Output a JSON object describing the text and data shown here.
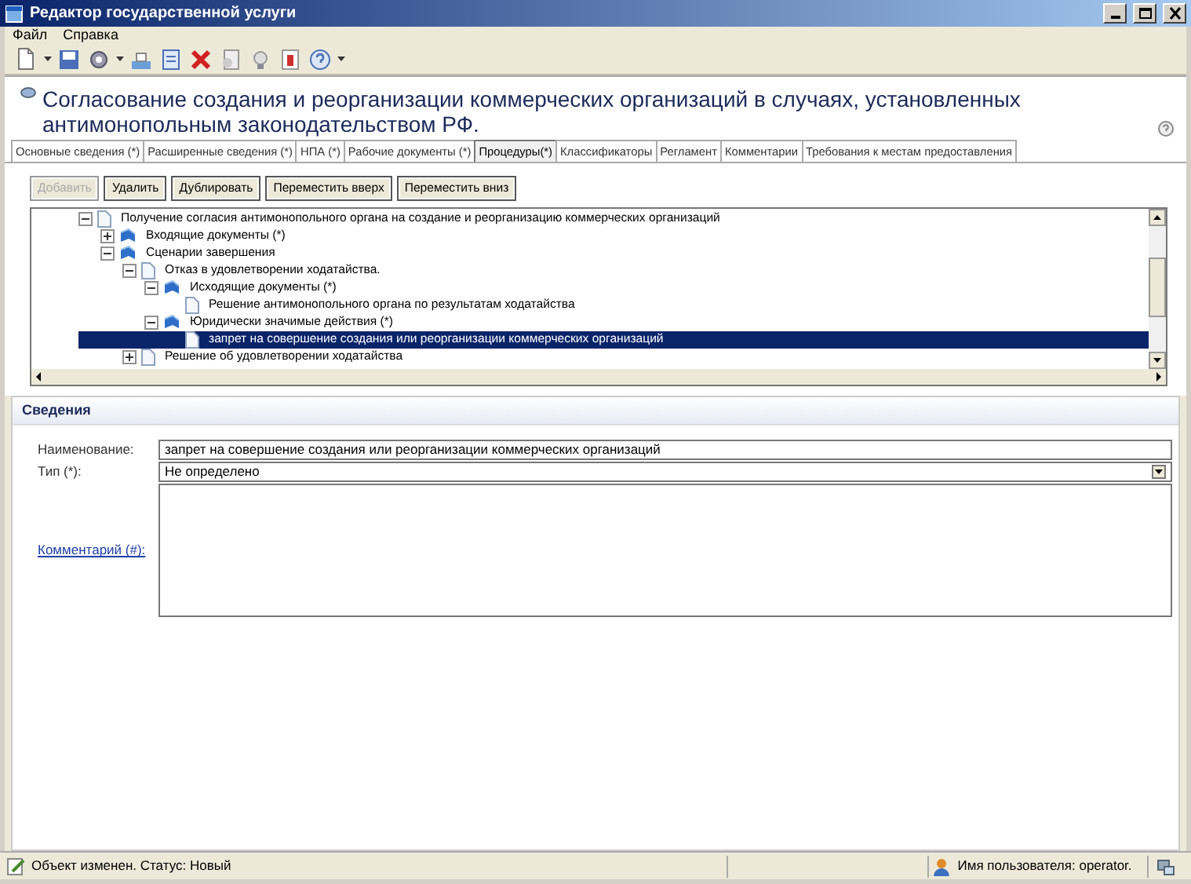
{
  "window": {
    "title": "Редактор государственной услуги"
  },
  "menu": [
    "Файл",
    "Справка"
  ],
  "header": {
    "title": "Согласование создания и реорганизации коммерческих организаций в случаях, установленных антимонопольным законодательством РФ."
  },
  "tabs": [
    {
      "label": "Основные сведения (*)",
      "selected": false
    },
    {
      "label": "Расширенные сведения (*)",
      "selected": false
    },
    {
      "label": "НПА (*)",
      "selected": false
    },
    {
      "label": "Рабочие документы (*)",
      "selected": false
    },
    {
      "label": "Процедуры(*)",
      "selected": true
    },
    {
      "label": "Классификаторы",
      "selected": false
    },
    {
      "label": "Регламент",
      "selected": false
    },
    {
      "label": "Комментарии",
      "selected": false
    },
    {
      "label": "Требования к местам предоставления",
      "selected": false
    }
  ],
  "buttons": [
    {
      "label": "Добавить",
      "disabled": true
    },
    {
      "label": "Удалить",
      "disabled": false
    },
    {
      "label": "Дублировать",
      "disabled": false
    },
    {
      "label": "Переместить вверх",
      "disabled": false
    },
    {
      "label": "Переместить вниз",
      "disabled": false
    }
  ],
  "tree": [
    {
      "label": "Получение согласия  антимонопольного органа на  создание и реорганизацию коммерческих организаций",
      "kind": "document",
      "expanded": true,
      "selected": false,
      "children": [
        {
          "label": "Входящие документы (*)",
          "kind": "folder",
          "expanded": false,
          "selected": false
        },
        {
          "label": "Сценарии завершения",
          "kind": "folder",
          "expanded": true,
          "selected": false,
          "children": [
            {
              "label": "Отказ в удовлетворении ходатайства.",
              "kind": "document",
              "expanded": true,
              "selected": false,
              "children": [
                {
                  "label": "Исходящие документы (*)",
                  "kind": "folder",
                  "expanded": true,
                  "selected": false,
                  "children": [
                    {
                      "label": "Решение антимонопольного органа по результатам ходатайства",
                      "kind": "document",
                      "selected": false
                    }
                  ]
                },
                {
                  "label": "Юридически значимые действия (*)",
                  "kind": "folder",
                  "expanded": true,
                  "selected": false,
                  "children": [
                    {
                      "label": "запрет на совершение создания или реорганизации коммерческих организаций",
                      "kind": "document",
                      "selected": true
                    }
                  ]
                }
              ]
            },
            {
              "label": "Решение об удовлетворении ходатайства",
              "kind": "document",
              "expanded": false,
              "selected": false
            }
          ]
        }
      ]
    }
  ],
  "details": {
    "title": "Сведения",
    "fields": [
      {
        "label": "Наименование:",
        "kind": "text",
        "value": "запрет на совершение создания или реорганизации коммерческих организаций"
      },
      {
        "label": "Тип (*):",
        "kind": "select",
        "value": "Не определено"
      },
      {
        "label": "Комментарий (#):",
        "kind": "textarea",
        "link": true
      }
    ]
  },
  "status_bar": {
    "message": "Объект изменен. Статус: Новый",
    "user": "Имя пользователя: operator."
  }
}
